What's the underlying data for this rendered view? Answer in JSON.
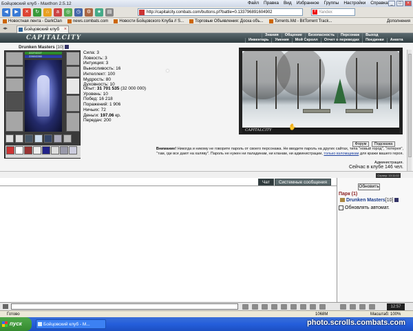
{
  "window": {
    "title": "Бойцовский клуб - Maxthon 2.5.12",
    "menus": [
      "Файл",
      "Правка",
      "Вид",
      "Избранное",
      "Группы",
      "Настройки",
      "Справка"
    ]
  },
  "toolbar": {
    "address": "http://capitalcity.combats.com/buttons.pl?battle=0.133796891604902",
    "search_placeholder": "Yandex"
  },
  "bookmarks": {
    "items": [
      "Новостная лента - DarkClan",
      "news.combats.com",
      "Новости Бойцовского Клуба // S...",
      "Торговые Объявления: Доска объ...",
      "Torrents.Md - BitTorrent Track..."
    ],
    "addons": "Дополнения"
  },
  "tab": {
    "label": "Бойцовский клуб"
  },
  "game": {
    "logo": "CAPITALCITY",
    "nav_top": [
      "Знания",
      "Общение",
      "Безопасность",
      "Персонаж",
      "Выход"
    ],
    "nav_bottom": [
      "Инвентарь",
      "Умения",
      "Мой Скролл",
      "Отчет о переводах",
      "Поединки",
      "Анкета"
    ],
    "character": {
      "name": "Drunken Masters",
      "level": "[10]",
      "hp": "2227/2227",
      "mp": "2260/2260"
    },
    "stats": [
      "Сила: 3",
      "Ловкость: 3",
      "Интуиция: 3",
      "Выносливость: 16",
      "Интеллект: 100",
      "Мудрость: 80",
      "Духовность: 10"
    ],
    "exp_label": "Опыт: ",
    "exp_value": "31 701 535",
    "exp_next": " (32 000 000)",
    "level_line": "Уровень: 10",
    "wins": "Побед: 16 218",
    "losses": "Поражений: 1 906",
    "draws": "Ничьих: 72",
    "money_label": "Деньги: ",
    "money_value": "197.06",
    "money_unit": " кр.",
    "transfers": "Передач: 200",
    "scene_caption": "CAPITALCITY",
    "forum_btn": "Форум",
    "hints_btn": "Подсказка",
    "warning_bold": "Внимание!",
    "warning_text": " Никогда и никому не говорите пароль от своего персонажа. Не вводите пароль на других сайтах, типа \"новый город\", \"лотерея\", \"там, где все дают на халяву\". Пароль не нужен ни паладинам, ни кланам, ни администрации,",
    "warning_link": "только взломщикам",
    "warning_tail": " для кражи вашего героя.",
    "admin": "Администрация.",
    "online": "Сейчас в клубе 146 чел.",
    "timestamp": "Сервер: 10:11:02"
  },
  "chat": {
    "tabs": [
      "Чат",
      "Системные сообщения"
    ]
  },
  "side": {
    "refresh": "Обновить",
    "park": "Парк (1)",
    "user": "Drunken Masters",
    "user_level": "[10]",
    "auto": "Обновлять автомат."
  },
  "chatbar": {
    "clock": "12:57"
  },
  "status": {
    "ready": "Готово",
    "zoom": "1068M",
    "mem": "Масштаб: 100%"
  },
  "taskbar": {
    "start": "пуск",
    "task": "Бойцовский клуб - M...",
    "watermark": "photo.scrolls.combats.com"
  }
}
